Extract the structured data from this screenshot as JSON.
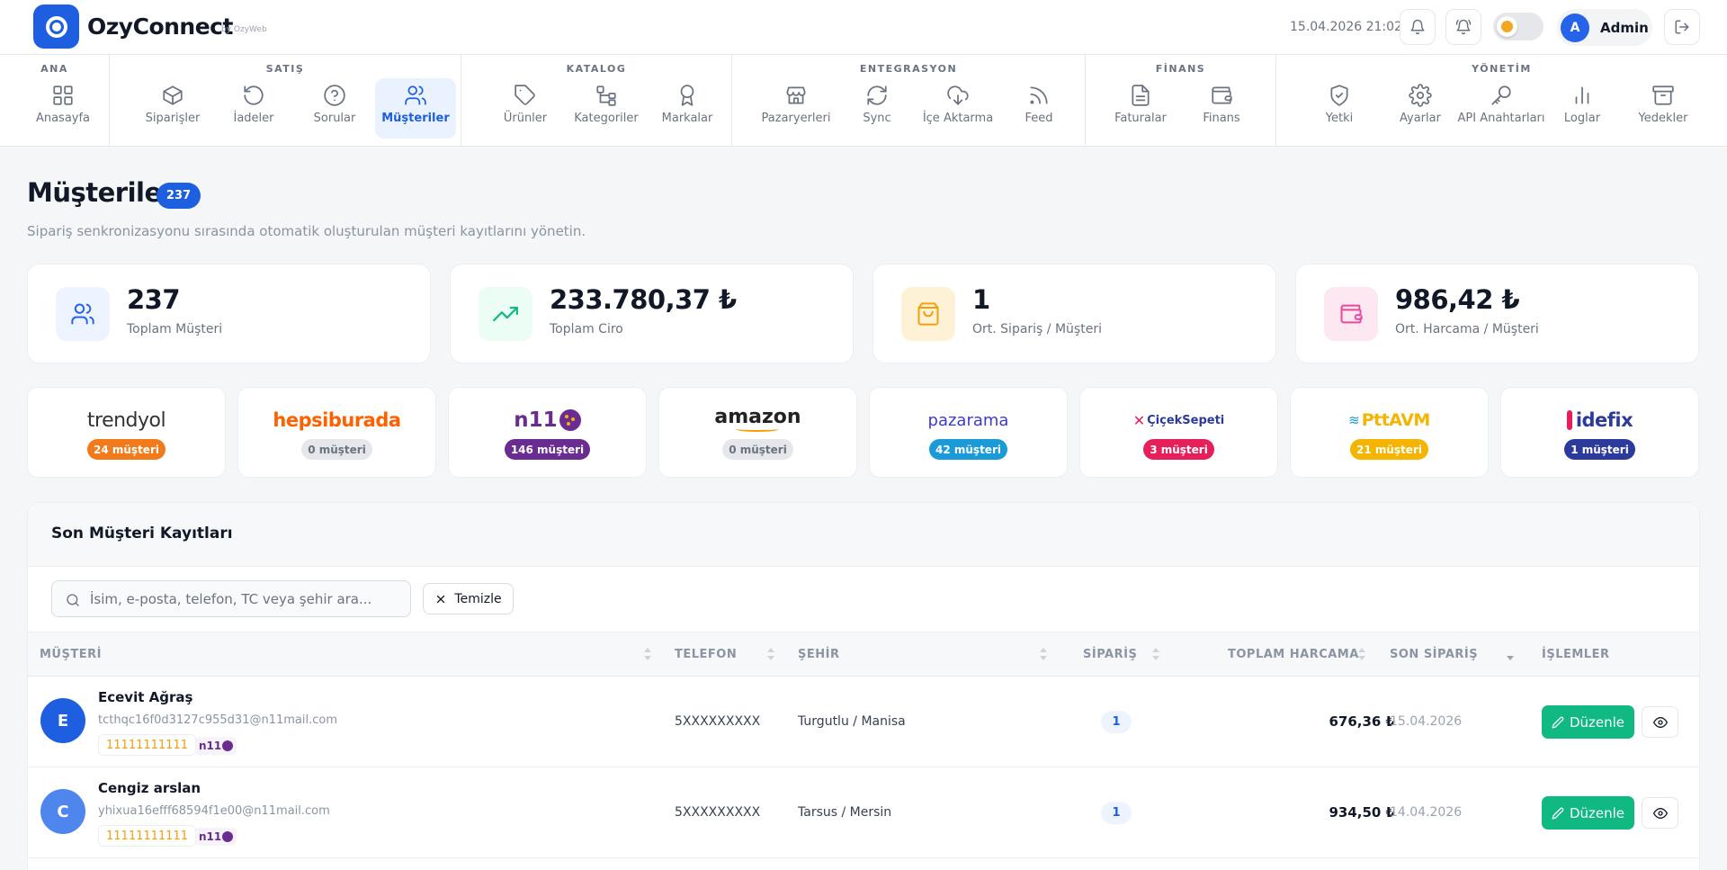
{
  "brand": {
    "name": "OzyConnect",
    "sub": "by OzyWeb"
  },
  "header": {
    "datetime": "15.04.2026 21:02",
    "user_initial": "A",
    "user_name": "Admin"
  },
  "nav": {
    "groups": [
      {
        "title": "ANA",
        "items": [
          {
            "label": "Anasayfa",
            "icon": "grid-icon"
          }
        ]
      },
      {
        "title": "SATIŞ",
        "items": [
          {
            "label": "Siparişler",
            "icon": "box-icon"
          },
          {
            "label": "İadeler",
            "icon": "undo-icon"
          },
          {
            "label": "Sorular",
            "icon": "question-icon"
          },
          {
            "label": "Müşteriler",
            "icon": "users-icon",
            "active": true
          }
        ]
      },
      {
        "title": "KATALOG",
        "items": [
          {
            "label": "Ürünler",
            "icon": "tag-icon"
          },
          {
            "label": "Kategoriler",
            "icon": "tree-icon"
          },
          {
            "label": "Markalar",
            "icon": "award-icon"
          }
        ]
      },
      {
        "title": "ENTEGRASYON",
        "items": [
          {
            "label": "Pazaryerleri",
            "icon": "store-icon"
          },
          {
            "label": "Sync",
            "icon": "refresh-icon"
          },
          {
            "label": "İçe Aktarma",
            "icon": "cloud-download-icon"
          },
          {
            "label": "Feed",
            "icon": "rss-icon"
          }
        ]
      },
      {
        "title": "FİNANS",
        "items": [
          {
            "label": "Faturalar",
            "icon": "file-icon"
          },
          {
            "label": "Finans",
            "icon": "wallet-icon"
          }
        ]
      },
      {
        "title": "YÖNETİM",
        "items": [
          {
            "label": "Yetki",
            "icon": "shield-icon"
          },
          {
            "label": "Ayarlar",
            "icon": "gear-icon"
          },
          {
            "label": "API Anahtarları",
            "icon": "key-icon"
          },
          {
            "label": "Loglar",
            "icon": "bar-chart-icon"
          },
          {
            "label": "Yedekler",
            "icon": "archive-icon"
          }
        ]
      }
    ]
  },
  "page": {
    "title": "Müşteriler",
    "count": "237",
    "subtitle": "Sipariş senkronizasyonu sırasında otomatik oluşturulan müşteri kayıtlarını yönetin."
  },
  "stats": [
    {
      "value": "237",
      "label": "Toplam Müşteri",
      "icon": "users-icon",
      "color": "#2563eb",
      "bg": "#eef4ff"
    },
    {
      "value": "233.780,37 ₺",
      "label": "Toplam Ciro",
      "icon": "trending-up-icon",
      "color": "#10b981",
      "bg": "#ecfdf5"
    },
    {
      "value": "1",
      "label": "Ort. Sipariş / Müşteri",
      "icon": "bag-icon",
      "color": "#f59e0b",
      "bg": "#fdf1d6"
    },
    {
      "value": "986,42 ₺",
      "label": "Ort. Harcama / Müşteri",
      "icon": "wallet-icon",
      "color": "#ec4899",
      "bg": "#fde7f1"
    }
  ],
  "marketplaces": [
    {
      "name": "trendyol",
      "count": "24 müşteri",
      "color": "#f27a1a"
    },
    {
      "name": "hepsiburada",
      "count": "0 müşteri",
      "color": "#e5e7eb"
    },
    {
      "name": "n11",
      "count": "146 müşteri",
      "color": "#6b2c91"
    },
    {
      "name": "amazon",
      "count": "0 müşteri",
      "color": "#e5e7eb"
    },
    {
      "name": "pazarama",
      "count": "42 müşteri",
      "color": "#1a9bd7"
    },
    {
      "name": "ÇiçekSepeti",
      "count": "3 müşteri",
      "color": "#e61e5a"
    },
    {
      "name": "PttAVM",
      "count": "21 müşteri",
      "color": "#f5b400"
    },
    {
      "name": "idefix",
      "count": "1 müşteri",
      "color": "#2b3a9b"
    }
  ],
  "table": {
    "title": "Son Müşteri Kayıtları",
    "search_placeholder": "İsim, e-posta, telefon, TC veya şehir ara...",
    "clear_label": "Temizle",
    "columns": {
      "customer": "MÜŞTERİ",
      "phone": "TELEFON",
      "city": "ŞEHİR",
      "orders": "SİPARİŞ",
      "total": "TOPLAM HARCAMA",
      "last": "SON SİPARİŞ",
      "actions": "İŞLEMLER"
    },
    "edit_label": "Düzenle",
    "rows": [
      {
        "initial": "E",
        "name": "Ecevit Ağraş",
        "email": "tcthqc16f0d3127c955d31@n11mail.com",
        "tc": "11111111111",
        "marketplace": "n11",
        "phone": "5XXXXXXXXX",
        "city": "Turgutlu / Manisa",
        "orders": "1",
        "total": "676,36 ₺",
        "last": "15.04.2026",
        "avatar_color": "#1d5fe0"
      },
      {
        "initial": "C",
        "name": "Cengiz arslan",
        "email": "yhixua16efff68594f1e00@n11mail.com",
        "tc": "11111111111",
        "marketplace": "n11",
        "phone": "5XXXXXXXXX",
        "city": "Tarsus / Mersin",
        "orders": "1",
        "total": "934,50 ₺",
        "last": "14.04.2026",
        "avatar_color": "#4f86ee"
      }
    ]
  },
  "colors": {
    "primary": "#1d5fe0",
    "success": "#10b981"
  }
}
